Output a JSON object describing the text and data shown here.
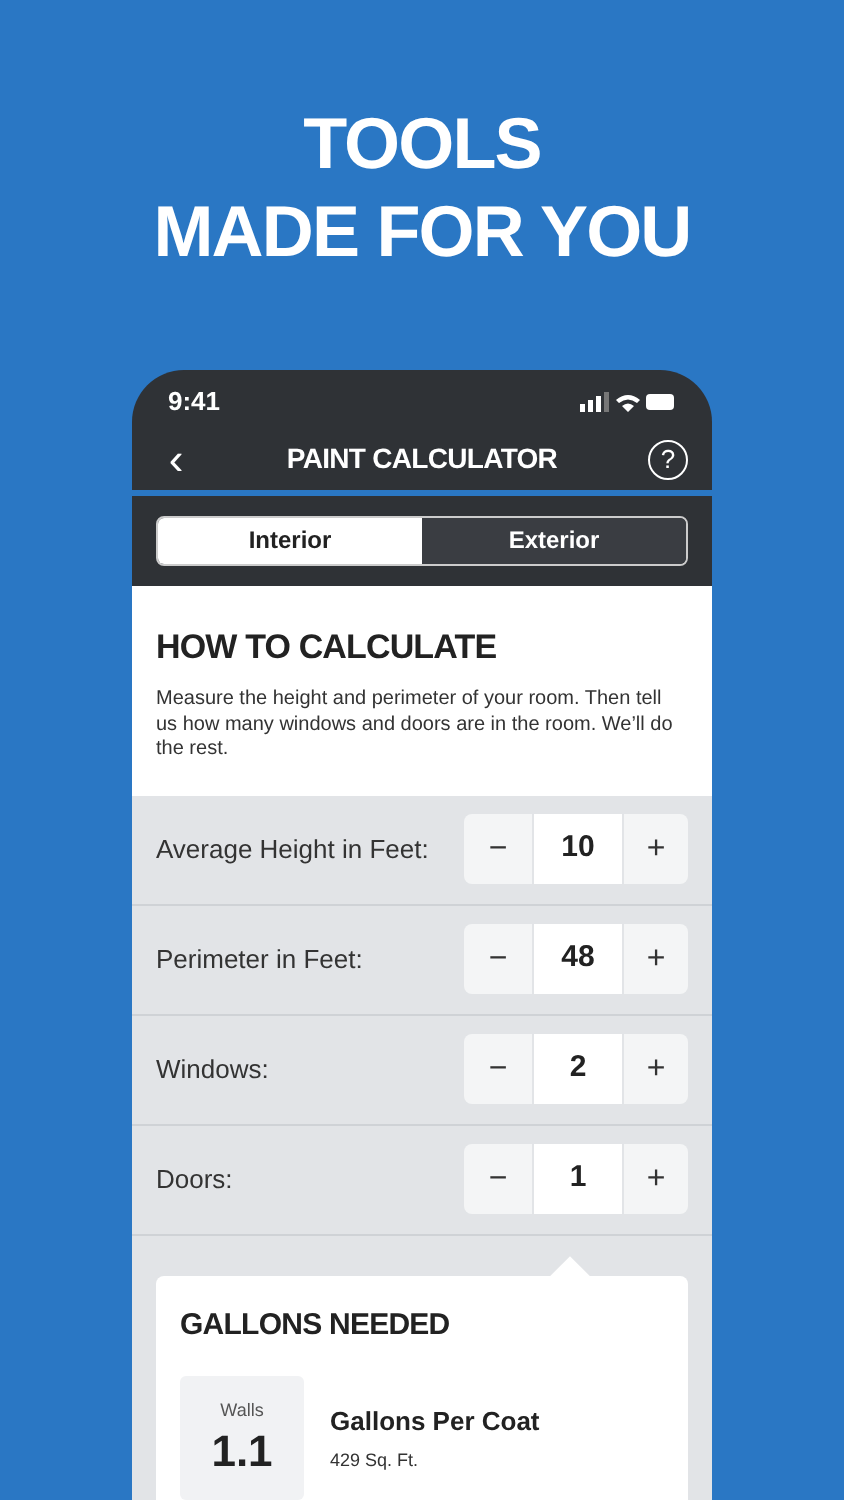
{
  "headline": [
    "TOOLS",
    "MADE FOR YOU"
  ],
  "status_bar": {
    "time": "9:41"
  },
  "nav": {
    "back": "‹",
    "title": "PAINT CALCULATOR",
    "help": "?"
  },
  "tabs": [
    {
      "label": "Interior",
      "selected": true
    },
    {
      "label": "Exterior",
      "selected": false
    }
  ],
  "intro": {
    "title": "HOW TO CALCULATE",
    "text": "Measure the height and perimeter of your room. Then tell us how many windows and doors are in the room. We’ll do the rest."
  },
  "inputs": [
    {
      "label": "Average Height in Feet:",
      "minus": "−",
      "value": "10",
      "plus": "+"
    },
    {
      "label": "Perimeter in Feet:",
      "minus": "−",
      "value": "48",
      "plus": "+"
    },
    {
      "label": "Windows:",
      "minus": "−",
      "value": "2",
      "plus": "+"
    },
    {
      "label": "Doors:",
      "minus": "−",
      "value": "1",
      "plus": "+"
    }
  ],
  "result": {
    "title": "GALLONS NEEDED",
    "tile_label": "Walls",
    "tile_value": "1.1",
    "heading": "Gallons Per Coat",
    "detail": "429 Sq. Ft."
  }
}
